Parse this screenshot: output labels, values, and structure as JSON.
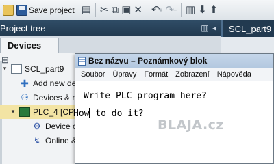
{
  "toolbar": {
    "save_label": "Save project"
  },
  "tree_panel": {
    "title": "Project tree",
    "tab": "Devices"
  },
  "tree": {
    "items": [
      {
        "label": "SCL_part9",
        "icon": "project-doc-icon"
      },
      {
        "label": "Add new de",
        "icon": "add-device-icon"
      },
      {
        "label": "Devices & n",
        "icon": "network-icon"
      },
      {
        "label": "PLC_4 [CPU",
        "icon": "plc-icon"
      },
      {
        "label": "Device c",
        "icon": "device-config-icon"
      },
      {
        "label": "Online &",
        "icon": "online-diagnostics-icon"
      }
    ]
  },
  "right_panel": {
    "tab": "SCL_part9"
  },
  "notepad": {
    "title": "Bez názvu – Poznámkový blok",
    "menu": [
      "Soubor",
      "Úpravy",
      "Formát",
      "Zobrazení",
      "Nápověda"
    ],
    "line1": "Write PLC program here?",
    "line2_before_caret": "How",
    "line2_after_caret": " to do it?"
  },
  "watermark": "BLAJA.cz",
  "colors": {
    "panel_header": "#2f4c66",
    "selected_row": "#f3e4a4",
    "notepad_title": "#c5d6ea"
  }
}
